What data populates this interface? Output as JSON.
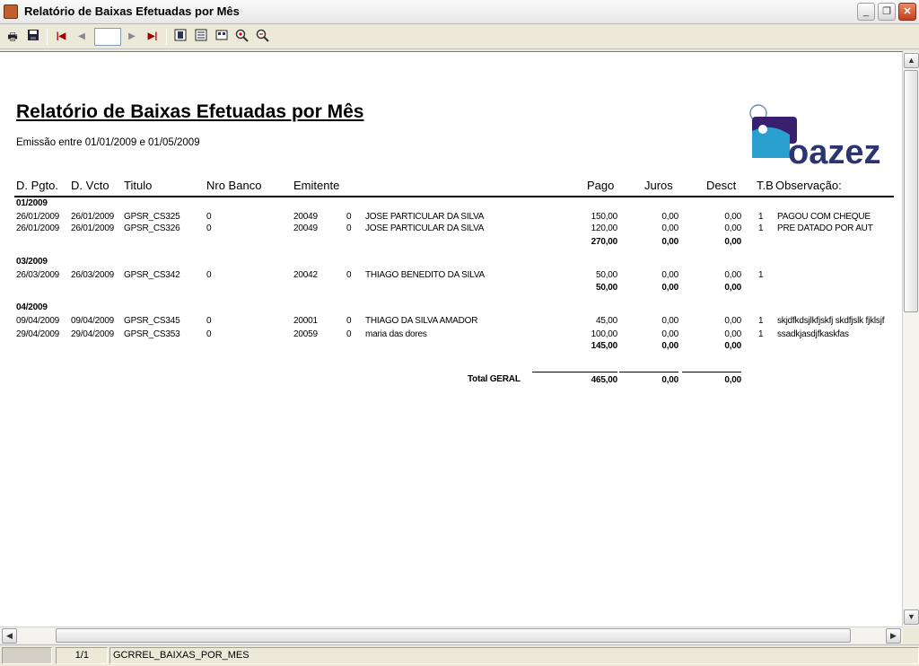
{
  "window": {
    "title": "Relatório de Baixas Efetuadas por Mês",
    "min": "_",
    "restore": "❐",
    "close": "✕"
  },
  "toolbar": {
    "page_value": ""
  },
  "report": {
    "title": "Relatório de Baixas Efetuadas por Mês",
    "subtitle": "Emissão entre 01/01/2009 e 01/05/2009",
    "logo_text": "oazez",
    "headers": {
      "d_pgto": "D. Pgto.",
      "d_vcto": "D. Vcto",
      "titulo": "Titulo",
      "nro_banco": "Nro Banco",
      "emitente": "Emitente",
      "pago": "Pago",
      "juros": "Juros",
      "desct": "Desct",
      "tb": "T.B",
      "obs": "Observação:"
    },
    "groups": [
      {
        "label": "01/2009",
        "rows": [
          {
            "d_pgto": "26/01/2009",
            "d_vcto": "26/01/2009",
            "titulo": "GPSR_CS325",
            "nro_banco": "0",
            "emitente": "20049",
            "zero": "0",
            "nome": "JOSE PARTICULAR DA SILVA",
            "pago": "150,00",
            "juros": "0,00",
            "desct": "0,00",
            "tb": "1",
            "obs": "PAGOU COM CHEQUE"
          },
          {
            "d_pgto": "26/01/2009",
            "d_vcto": "26/01/2009",
            "titulo": "GPSR_CS326",
            "nro_banco": "0",
            "emitente": "20049",
            "zero": "0",
            "nome": "JOSE PARTICULAR DA SILVA",
            "pago": "120,00",
            "juros": "0,00",
            "desct": "0,00",
            "tb": "1",
            "obs": "PRE DATADO POR AUT"
          }
        ],
        "total": {
          "pago": "270,00",
          "juros": "0,00",
          "desct": "0,00"
        }
      },
      {
        "label": "03/2009",
        "rows": [
          {
            "d_pgto": "26/03/2009",
            "d_vcto": "26/03/2009",
            "titulo": "GPSR_CS342",
            "nro_banco": "0",
            "emitente": "20042",
            "zero": "0",
            "nome": "THIAGO BENEDITO DA SILVA",
            "pago": "50,00",
            "juros": "0,00",
            "desct": "0,00",
            "tb": "1",
            "obs": ""
          }
        ],
        "total": {
          "pago": "50,00",
          "juros": "0,00",
          "desct": "0,00"
        }
      },
      {
        "label": "04/2009",
        "rows": [
          {
            "d_pgto": "09/04/2009",
            "d_vcto": "09/04/2009",
            "titulo": "GPSR_CS345",
            "nro_banco": "0",
            "emitente": "20001",
            "zero": "0",
            "nome": "THIAGO DA SILVA AMADOR",
            "pago": "45,00",
            "juros": "0,00",
            "desct": "0,00",
            "tb": "1",
            "obs": "skjdfkdsjlkfjskfj skdfjslk fjklsjf"
          },
          {
            "d_pgto": "29/04/2009",
            "d_vcto": "29/04/2009",
            "titulo": "GPSR_CS353",
            "nro_banco": "0",
            "emitente": "20059",
            "zero": "0",
            "nome": "maria das dores",
            "pago": "100,00",
            "juros": "0,00",
            "desct": "0,00",
            "tb": "1",
            "obs": "ssadkjasdjfkaskfas"
          }
        ],
        "total": {
          "pago": "145,00",
          "juros": "0,00",
          "desct": "0,00"
        }
      }
    ],
    "grand_total": {
      "label": "Total GERAL",
      "pago": "465,00",
      "juros": "0,00",
      "desct": "0,00"
    }
  },
  "status": {
    "page": "1/1",
    "report_name": "GCRREL_BAIXAS_POR_MES"
  }
}
